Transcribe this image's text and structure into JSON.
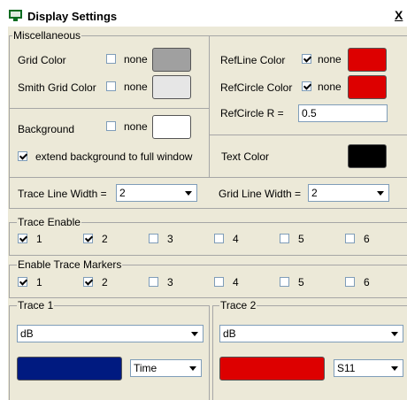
{
  "window": {
    "title": "Display Settings",
    "close_label": "X"
  },
  "misc": {
    "group_label": "Miscellaneous",
    "grid_color_label": "Grid Color",
    "grid_none_label": "none",
    "smith_grid_color_label": "Smith Grid Color",
    "smith_none_label": "none",
    "refline_color_label": "RefLine Color",
    "refline_none_label": "none",
    "refcircle_color_label": "RefCircle Color",
    "refcircle_none_label": "none",
    "refcircle_r_label": "RefCircle R =",
    "refcircle_r_value": "0.5",
    "background_label": "Background",
    "background_none_label": "none",
    "extend_background_label": "extend background to full window",
    "text_color_label": "Text Color",
    "trace_line_width_label": "Trace Line Width =",
    "trace_line_width_value": "2",
    "grid_line_width_label": "Grid Line Width =",
    "grid_line_width_value": "2"
  },
  "colors": {
    "grid": "#a0a0a0",
    "smith_grid": "#e6e6e6",
    "refline": "#dd0000",
    "refcircle": "#dd0000",
    "background": "#ffffff",
    "text": "#000000",
    "trace1": "#001a80",
    "trace2": "#dd0000"
  },
  "checks": {
    "grid_none": false,
    "smith_none": false,
    "refline_none": true,
    "refcircle_none": true,
    "background_none": false,
    "extend_background": true
  },
  "trace_enable": {
    "group_label": "Trace Enable",
    "items": [
      {
        "label": "1",
        "checked": true
      },
      {
        "label": "2",
        "checked": true
      },
      {
        "label": "3",
        "checked": false
      },
      {
        "label": "4",
        "checked": false
      },
      {
        "label": "5",
        "checked": false
      },
      {
        "label": "6",
        "checked": false
      }
    ]
  },
  "trace_markers": {
    "group_label": "Enable Trace Markers",
    "items": [
      {
        "label": "1",
        "checked": true
      },
      {
        "label": "2",
        "checked": true
      },
      {
        "label": "3",
        "checked": false
      },
      {
        "label": "4",
        "checked": false
      },
      {
        "label": "5",
        "checked": false
      },
      {
        "label": "6",
        "checked": false
      }
    ]
  },
  "trace1": {
    "group_label": "Trace 1",
    "format_value": "dB",
    "domain_value": "Time"
  },
  "trace2": {
    "group_label": "Trace 2",
    "format_value": "dB",
    "param_value": "S11"
  }
}
